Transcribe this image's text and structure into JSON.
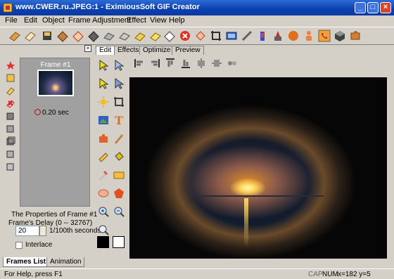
{
  "window": {
    "title": "www.CWER.ru.JPEG:1 - EximiousSoft GIF Creator",
    "controls": [
      "minimize",
      "maximize",
      "close"
    ],
    "minimize_glyph": "_",
    "maximize_glyph": "□",
    "close_glyph": "×"
  },
  "menubar": {
    "items": [
      "File",
      "Edit",
      "Object",
      "Frame",
      "Adjustment",
      "Effect",
      "View",
      "Help"
    ]
  },
  "toolbar": {
    "icons": [
      "open-icon",
      "new-icon",
      "save-icon",
      "film-icon",
      "wizard-icon",
      "video-icon",
      "import-icon",
      "export-icon",
      "folder-icon",
      "folder-open-icon",
      "eraser-icon",
      "stop-icon",
      "tag-icon",
      "crop-icon",
      "preview-icon",
      "wand-icon",
      "bottle-icon",
      "paint-icon",
      "ball-icon",
      "figure-icon",
      "phone-icon",
      "cube-icon",
      "puzzle-icon"
    ]
  },
  "left_panel": {
    "close_glyph": "×",
    "sidebar_icons": [
      "star-icon",
      "layers-icon",
      "note-icon",
      "delete-icon",
      "copy-icon",
      "paste-icon",
      "duplicate-icon",
      "move-up-icon",
      "move-down-icon"
    ],
    "frame": {
      "title": "Frame #1",
      "delay": "0.20 sec"
    },
    "properties": {
      "title": "The Properties of Frame #1",
      "delay_label": "Frame's Delay (0 -- 32767)",
      "delay_value": "20",
      "delay_unit": "1/100th seconds",
      "interlace_label": "Interlace",
      "interlace_checked": false
    },
    "tabs": [
      "Frames List",
      "Animation"
    ],
    "active_tab": "Frames List"
  },
  "editor": {
    "tabs": [
      "Edit",
      "Effects",
      "Optimize",
      "Preview"
    ],
    "active_tab": "Edit",
    "tools": [
      "arrow-icon",
      "select-icon",
      "magic-select-icon",
      "lasso-icon",
      "zoom-sun-icon",
      "crop-tool-icon",
      "image-icon",
      "text-icon",
      "puzzle-tool-icon",
      "pen-icon",
      "pencil-icon",
      "fill-icon",
      "dropper-icon",
      "rectangle-icon",
      "ellipse-icon",
      "polygon-icon",
      "zoom-in-icon",
      "zoom-out-icon",
      "zoom-icon"
    ],
    "foreground_color": "#000000",
    "background_color": "#ffffff",
    "align_tools": [
      "align-left-icon",
      "align-right-icon",
      "align-top-icon",
      "align-bottom-icon",
      "center-horizontal-icon",
      "center-vertical-icon",
      "group-icon"
    ]
  },
  "statusbar": {
    "help": "For Help, press F1",
    "cap": "CAP",
    "num": "NUM",
    "coords": "x=182  y=5"
  },
  "colors": {
    "titlebar": "#0a3fb0",
    "face": "#d4d0c8",
    "frames_bg": "#a0a0a0"
  }
}
